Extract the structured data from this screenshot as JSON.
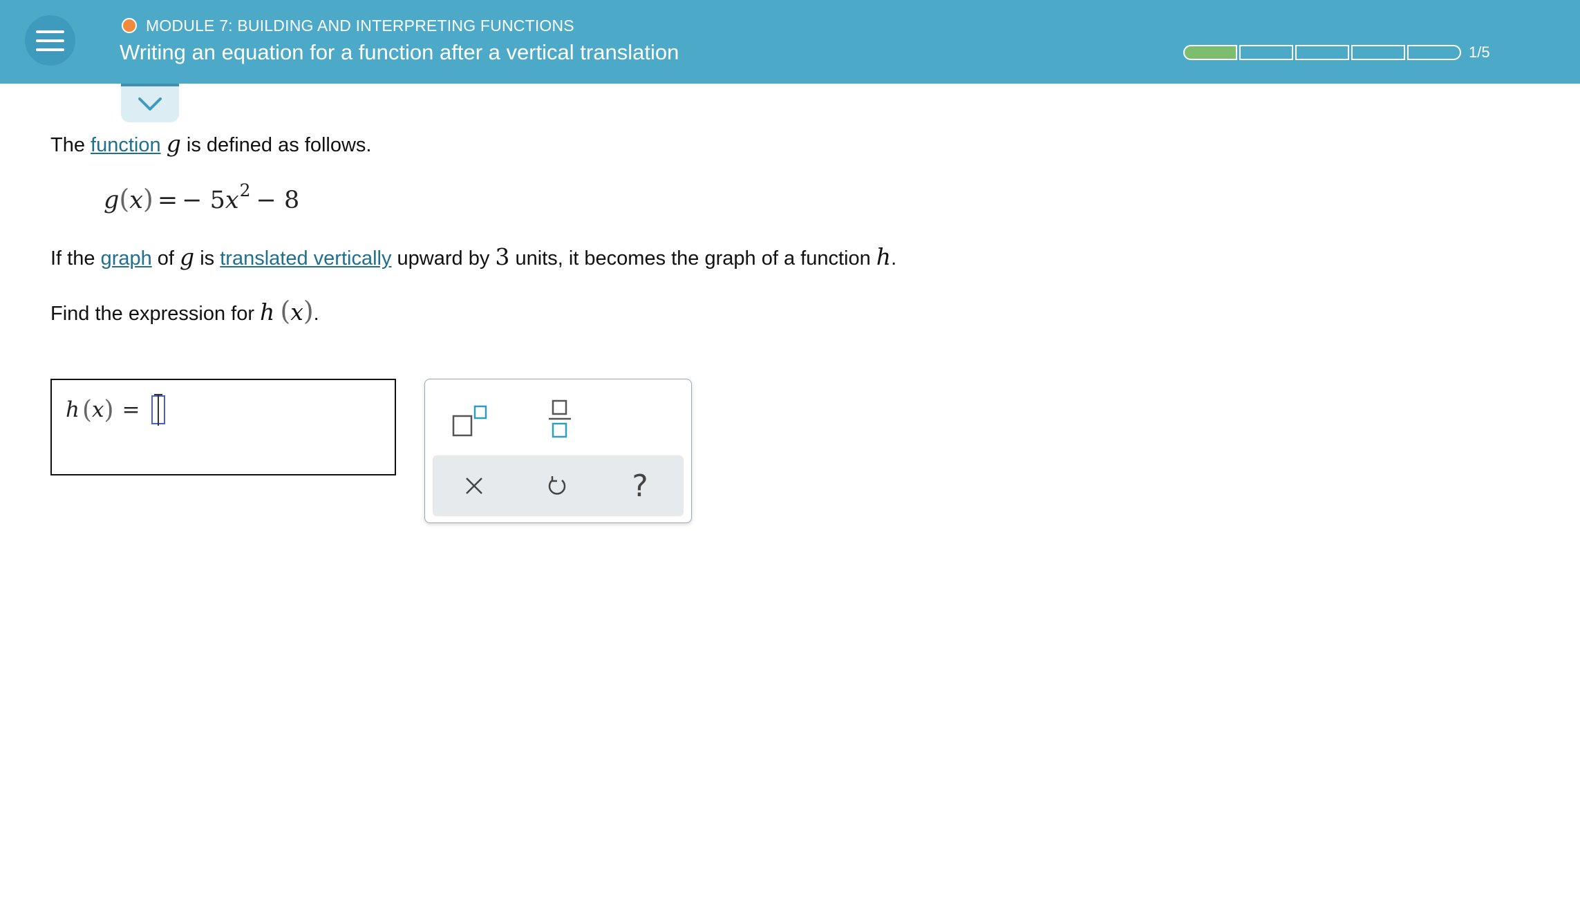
{
  "header": {
    "module": "MODULE 7: BUILDING AND INTERPRETING FUNCTIONS",
    "title": "Writing an equation for a function after a vertical translation",
    "progress": {
      "current": 1,
      "total": 5,
      "label": "1/5"
    },
    "colors": {
      "bar": "#4da9c8",
      "module_dot": "#f28a3c",
      "progress_fill": "#7cbd6e"
    }
  },
  "problem": {
    "line1": {
      "pre": "The",
      "link": "function",
      "var": "g",
      "post": "is defined as follows."
    },
    "equation": {
      "fn": "g",
      "arg": "x",
      "eq": "=",
      "rhs_a": "− 5",
      "var": "x",
      "exp": "2",
      "rhs_b": "− 8"
    },
    "line3": {
      "pre": "If the",
      "link1": "graph",
      "of": "of",
      "var": "g",
      "is": "is",
      "link2": "translated vertically",
      "mid": "upward by",
      "num": "3",
      "post": "units, it becomes the graph of a function",
      "var2": "h",
      "end": "."
    },
    "line4": {
      "pre": "Find the expression for",
      "fn": "h",
      "arg": "x",
      "end": "."
    }
  },
  "answer": {
    "fn": "h",
    "arg": "x",
    "eq": "="
  },
  "palette": {
    "tools": [
      "superscript-icon",
      "fraction-icon"
    ],
    "actions": [
      "clear-icon",
      "undo-icon",
      "help-icon"
    ],
    "help_label": "?"
  }
}
